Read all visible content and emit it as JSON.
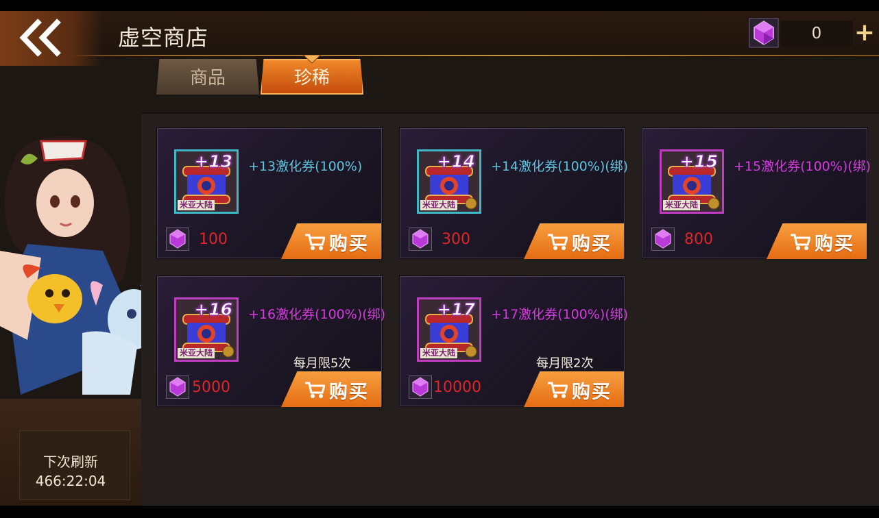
{
  "header": {
    "title": "虚空商店",
    "back_icon": "double-chevron-left-icon",
    "currency": {
      "icon": "purple-gem-icon",
      "value": "0",
      "add_label": "+"
    }
  },
  "tabs": [
    {
      "label": "商品",
      "active": false
    },
    {
      "label": "珍稀",
      "active": true
    }
  ],
  "sidebar": {
    "refresh_label": "下次刷新",
    "refresh_time": "466:22:04"
  },
  "items": [
    {
      "level": "+13",
      "name": "+13激化券(100%)",
      "rarity": "blue",
      "price": "100",
      "limit": "",
      "buy_label": "购买",
      "region_tag": "米亚大陆"
    },
    {
      "level": "+14",
      "name": "+14激化券(100%)(绑)",
      "rarity": "blue",
      "price": "300",
      "limit": "",
      "buy_label": "购买",
      "region_tag": "米亚大陆"
    },
    {
      "level": "+15",
      "name": "+15激化券(100%)(绑)",
      "rarity": "purple",
      "price": "800",
      "limit": "",
      "buy_label": "购买",
      "region_tag": "米亚大陆"
    },
    {
      "level": "+16",
      "name": "+16激化券(100%)(绑)",
      "rarity": "purple",
      "price": "5000",
      "limit": "每月限5次",
      "buy_label": "购买",
      "region_tag": "米亚大陆"
    },
    {
      "level": "+17",
      "name": "+17激化券(100%)(绑)",
      "rarity": "purple",
      "price": "10000",
      "limit": "每月限2次",
      "buy_label": "购买",
      "region_tag": "米亚大陆"
    }
  ],
  "colors": {
    "accent_orange": "#f28a2a",
    "price_red": "#e0262a",
    "name_blue": "#5fc4e0",
    "name_purple": "#d63be0"
  }
}
